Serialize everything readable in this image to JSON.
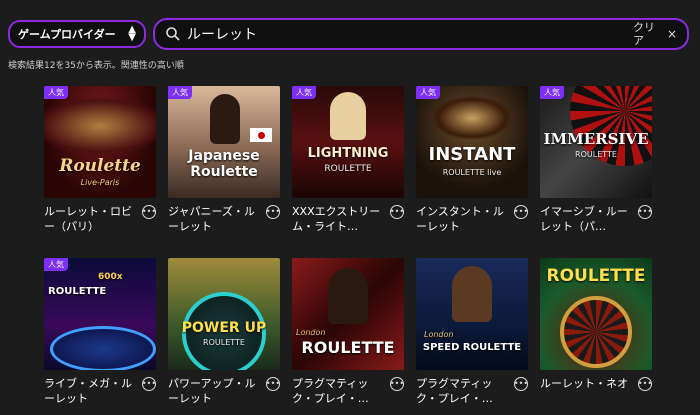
{
  "header": {
    "provider_label": "ゲームプロバイダー",
    "search_query": "ルーレット",
    "clear_label": "クリア",
    "clear_x": "×"
  },
  "result_text": "検索結果12を35から表示。関連性の高い順",
  "games": [
    {
      "name": "ルーレット・ロビー（パリ）",
      "badge": "人気",
      "thumb_title": "Roulette",
      "thumb_sub": "Live-Paris"
    },
    {
      "name": "ジャパニーズ・ルーレット",
      "badge": "人気",
      "thumb_title": "Japanese Roulette",
      "thumb_sub": ""
    },
    {
      "name": "XXXエクストリーム・ライト…",
      "badge": "人気",
      "thumb_title": "LIGHTNING",
      "thumb_sub": "ROULETTE"
    },
    {
      "name": "インスタント・ルーレット",
      "badge": "人気",
      "thumb_title": "INSTANT",
      "thumb_sub": "ROULETTE live"
    },
    {
      "name": "イマーシブ・ルーレット（パ…",
      "badge": "人気",
      "thumb_title": "IMMERSIVE",
      "thumb_sub": "ROULETTE"
    },
    {
      "name": "ライブ・メガ・ルーレット",
      "badge": "人気",
      "thumb_title": "ROULETTE",
      "thumb_sub": "600x"
    },
    {
      "name": "パワーアップ・ルーレット",
      "badge": "",
      "thumb_title": "POWER UP",
      "thumb_sub": "ROULETTE"
    },
    {
      "name": "プラグマティック・プレイ・…",
      "badge": "",
      "thumb_title": "ROULETTE",
      "thumb_sub": "London"
    },
    {
      "name": "プラグマティック・プレイ・…",
      "badge": "",
      "thumb_title": "SPEED ROULETTE",
      "thumb_sub": "London"
    },
    {
      "name": "ルーレット・ネオ",
      "badge": "",
      "thumb_title": "ROULETTE",
      "thumb_sub": ""
    }
  ],
  "more_icon": "ellipsis-circle-icon",
  "search_icon": "search-icon",
  "accent_color": "#8a2be2",
  "badge_color": "#7b2ff7"
}
